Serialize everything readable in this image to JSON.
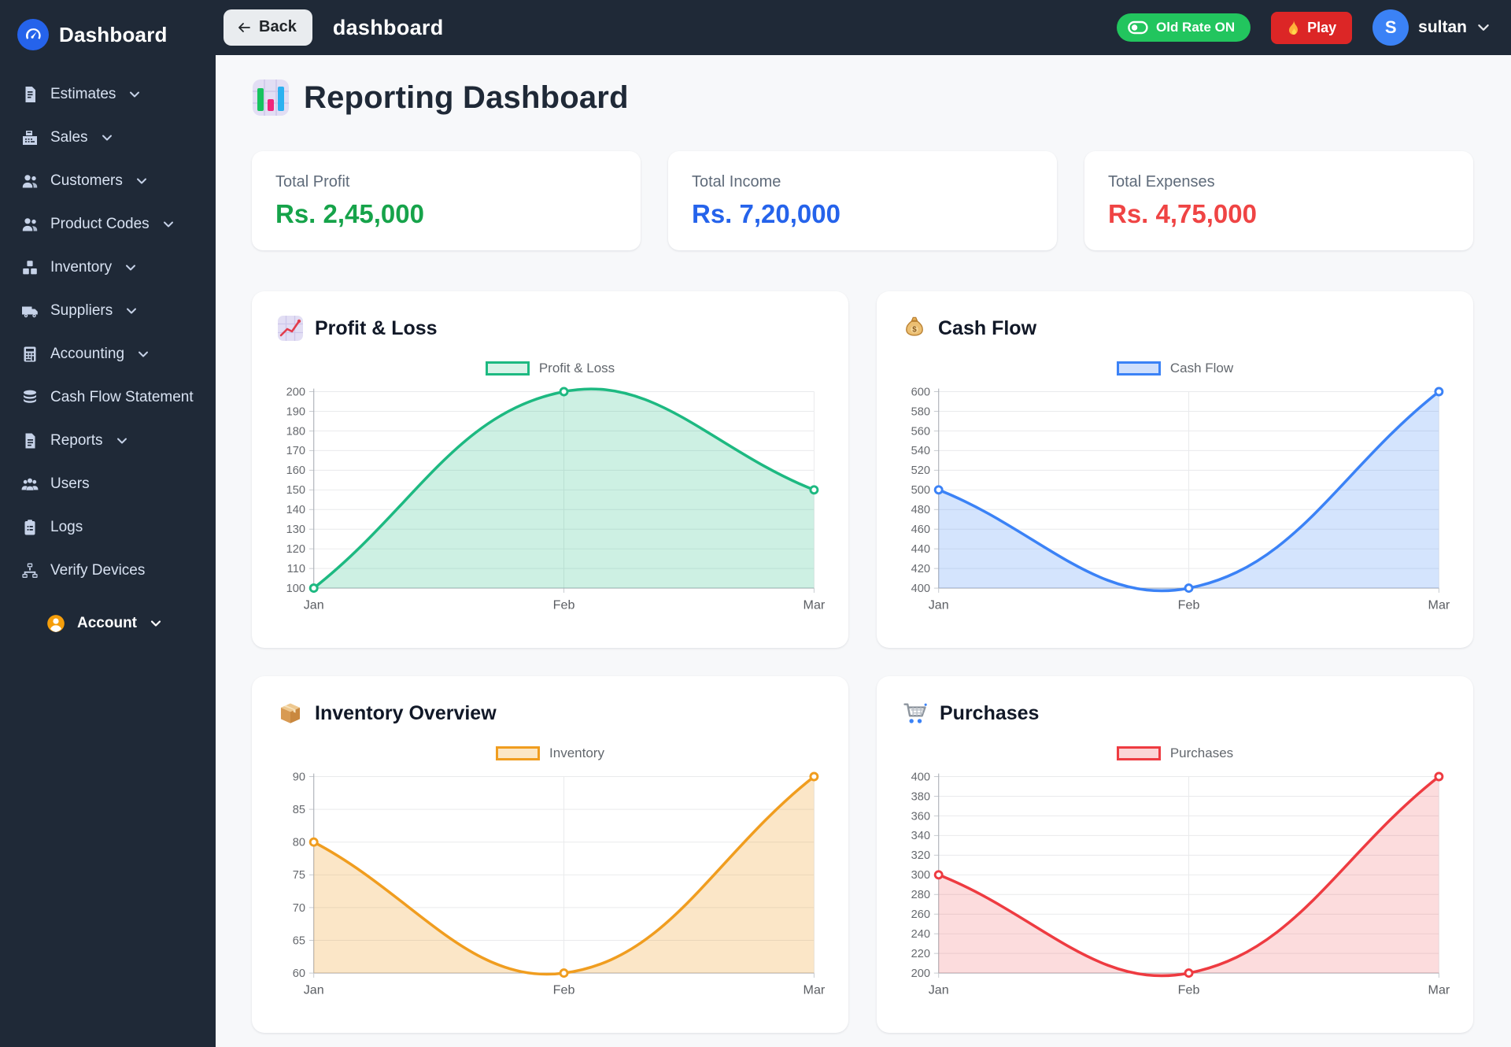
{
  "app": {
    "name": "Dashboard"
  },
  "topbar": {
    "back_label": "Back",
    "page_title": "dashboard",
    "old_rate_label": "Old Rate ON",
    "play_label": "Play",
    "avatar_initial": "S",
    "username": "sultan"
  },
  "sidebar": {
    "items": [
      {
        "label": "Estimates",
        "icon": "estimates-icon",
        "has_chevron": true
      },
      {
        "label": "Sales",
        "icon": "sales-icon",
        "has_chevron": true
      },
      {
        "label": "Customers",
        "icon": "customers-icon",
        "has_chevron": true
      },
      {
        "label": "Product Codes",
        "icon": "product-codes-icon",
        "has_chevron": true
      },
      {
        "label": "Inventory",
        "icon": "inventory-icon",
        "has_chevron": true
      },
      {
        "label": "Suppliers",
        "icon": "suppliers-icon",
        "has_chevron": true
      },
      {
        "label": "Accounting",
        "icon": "accounting-icon",
        "has_chevron": true
      },
      {
        "label": "Cash Flow Statement",
        "icon": "cash-flow-statement-icon",
        "has_chevron": false
      },
      {
        "label": "Reports",
        "icon": "reports-icon",
        "has_chevron": true
      },
      {
        "label": "Users",
        "icon": "users-icon",
        "has_chevron": false
      },
      {
        "label": "Logs",
        "icon": "logs-icon",
        "has_chevron": false
      },
      {
        "label": "Verify Devices",
        "icon": "verify-devices-icon",
        "has_chevron": false
      }
    ],
    "account_label": "Account"
  },
  "main": {
    "title": "Reporting Dashboard"
  },
  "stats": [
    {
      "label": "Total Profit",
      "value": "Rs. 2,45,000",
      "color": "#16a34a"
    },
    {
      "label": "Total Income",
      "value": "Rs. 7,20,000",
      "color": "#2563eb"
    },
    {
      "label": "Total Expenses",
      "value": "Rs. 4,75,000",
      "color": "#ef4444"
    }
  ],
  "chart_data": [
    {
      "type": "area",
      "title": "Profit & Loss",
      "legend": "Profit & Loss",
      "legend_position": "top",
      "categories": [
        "Jan",
        "Feb",
        "Mar"
      ],
      "values": [
        100,
        200,
        150
      ],
      "ylim": [
        100,
        200
      ],
      "ytick_step": 10,
      "xlabel": "",
      "ylabel": "",
      "grid": true,
      "line_color": "#1db981",
      "fill_color": "rgba(29,185,129,0.22)",
      "legend_fill": "#d8f3e8"
    },
    {
      "type": "area",
      "title": "Cash Flow",
      "legend": "Cash Flow",
      "legend_position": "top",
      "categories": [
        "Jan",
        "Feb",
        "Mar"
      ],
      "values": [
        500,
        400,
        600
      ],
      "ylim": [
        400,
        600
      ],
      "ytick_step": 20,
      "xlabel": "",
      "ylabel": "",
      "grid": true,
      "line_color": "#3b82f6",
      "fill_color": "rgba(59,130,246,0.22)",
      "legend_fill": "#cfdffc"
    },
    {
      "type": "area",
      "title": "Inventory Overview",
      "legend": "Inventory",
      "legend_position": "top",
      "categories": [
        "Jan",
        "Feb",
        "Mar"
      ],
      "values": [
        80,
        60,
        90
      ],
      "ylim": [
        60,
        90
      ],
      "ytick_step": 5,
      "xlabel": "",
      "ylabel": "",
      "grid": true,
      "line_color": "#f09d1f",
      "fill_color": "rgba(240,157,31,0.25)",
      "legend_fill": "#fbe7c6"
    },
    {
      "type": "area",
      "title": "Purchases",
      "legend": "Purchases",
      "legend_position": "top",
      "categories": [
        "Jan",
        "Feb",
        "Mar"
      ],
      "values": [
        300,
        200,
        400
      ],
      "ylim": [
        200,
        400
      ],
      "ytick_step": 20,
      "xlabel": "",
      "ylabel": "",
      "grid": true,
      "line_color": "#ee3b41",
      "fill_color": "rgba(238,59,65,0.18)",
      "legend_fill": "#fbd5d6"
    }
  ]
}
